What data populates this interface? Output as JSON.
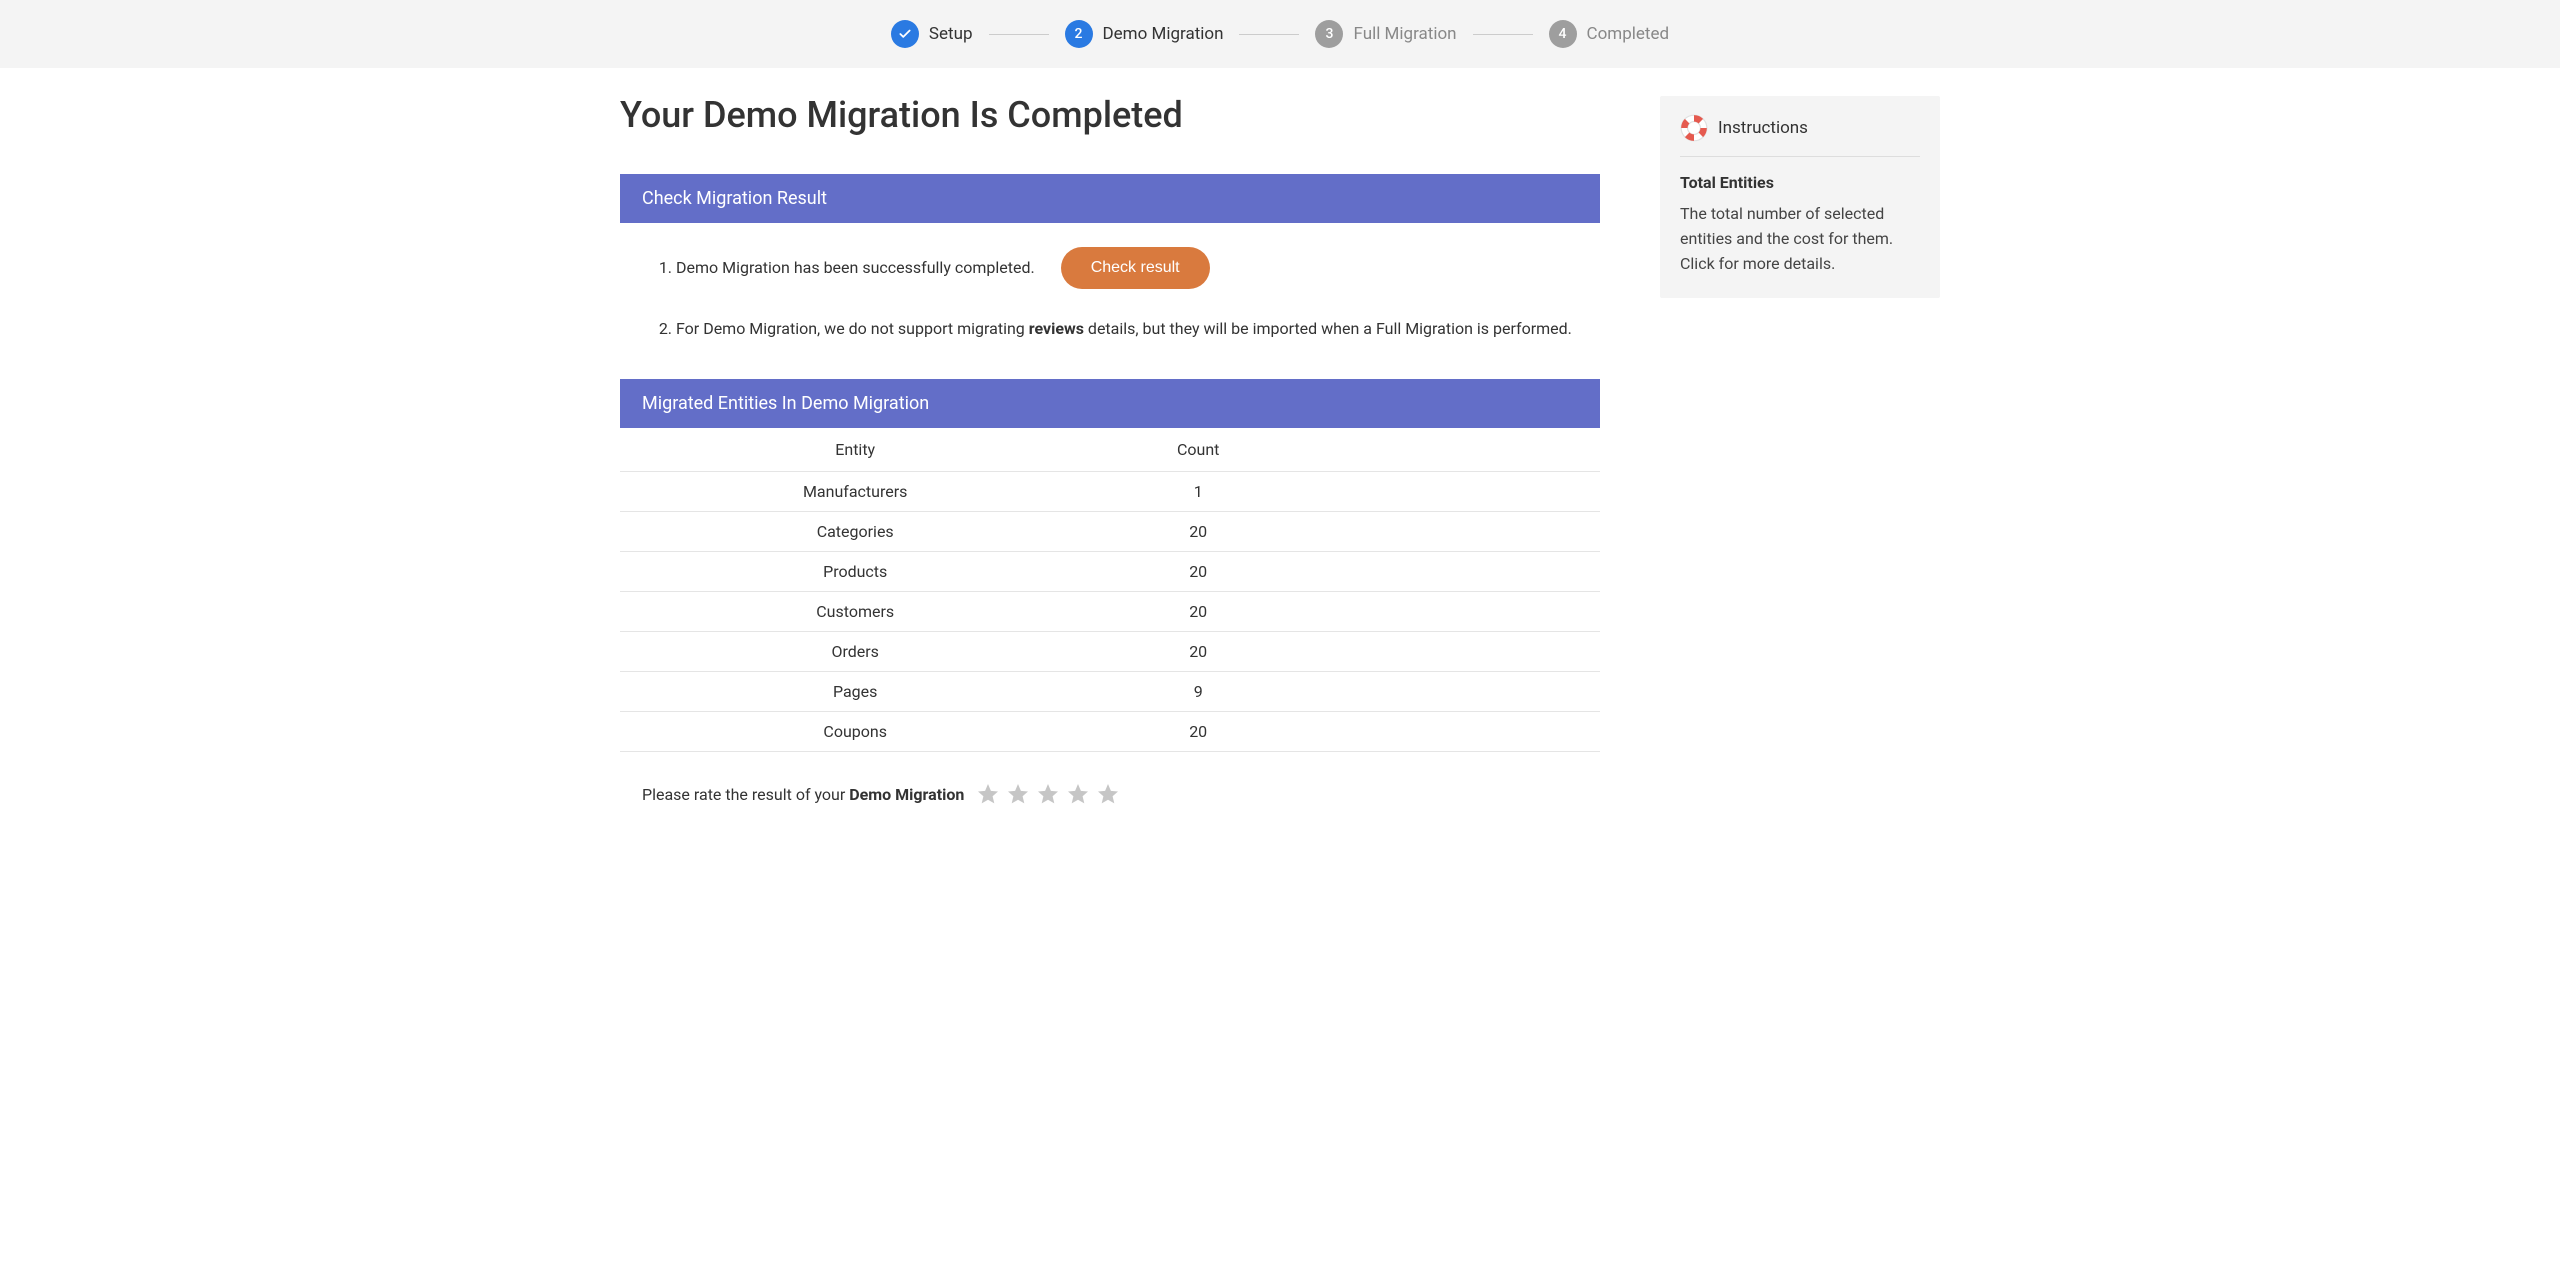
{
  "stepper": {
    "steps": [
      {
        "label": "Setup",
        "state": "done",
        "mark": "✓"
      },
      {
        "label": "Demo Migration",
        "state": "active",
        "mark": "2"
      },
      {
        "label": "Full Migration",
        "state": "inactive",
        "mark": "3"
      },
      {
        "label": "Completed",
        "state": "inactive",
        "mark": "4"
      }
    ]
  },
  "page": {
    "title": "Your Demo Migration Is Completed"
  },
  "check_panel": {
    "header": "Check Migration Result",
    "item1_text": "Demo Migration has been successfully completed.",
    "button_label": "Check result",
    "item2_prefix": "For Demo Migration, we do not support migrating ",
    "item2_bold": "reviews",
    "item2_suffix": " details, but they will be imported when a Full Migration is performed."
  },
  "entities_panel": {
    "header": "Migrated Entities In Demo Migration",
    "columns": {
      "entity": "Entity",
      "count": "Count"
    },
    "rows": [
      {
        "entity": "Manufacturers",
        "count": "1"
      },
      {
        "entity": "Categories",
        "count": "20"
      },
      {
        "entity": "Products",
        "count": "20"
      },
      {
        "entity": "Customers",
        "count": "20"
      },
      {
        "entity": "Orders",
        "count": "20"
      },
      {
        "entity": "Pages",
        "count": "9"
      },
      {
        "entity": "Coupons",
        "count": "20"
      }
    ]
  },
  "rating": {
    "prefix": "Please rate the result of your ",
    "bold": "Demo Migration"
  },
  "sidebar": {
    "title": "Instructions",
    "section_title": "Total Entities",
    "section_text": "The total number of selected entities and the cost for them. Click for more details."
  }
}
